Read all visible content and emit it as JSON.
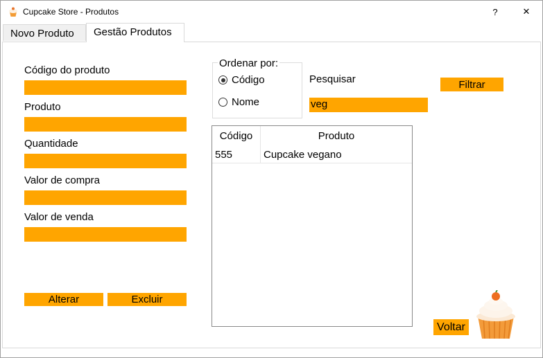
{
  "window": {
    "title": "Cupcake Store - Produtos",
    "help_label": "?",
    "close_label": "✕"
  },
  "tabs": [
    {
      "label": "Novo Produto",
      "active": false
    },
    {
      "label": "Gestão Produtos",
      "active": true
    }
  ],
  "form": {
    "codigo_label": "Código do produto",
    "codigo_value": "",
    "produto_label": "Produto",
    "produto_value": "",
    "quantidade_label": "Quantidade",
    "quantidade_value": "",
    "valor_compra_label": "Valor de compra",
    "valor_compra_value": "",
    "valor_venda_label": "Valor de venda",
    "valor_venda_value": "",
    "alterar_label": "Alterar",
    "excluir_label": "Excluir"
  },
  "order": {
    "legend": "Ordenar por:",
    "options": [
      {
        "label": "Código",
        "checked": true
      },
      {
        "label": "Nome",
        "checked": false
      }
    ]
  },
  "search": {
    "label": "Pesquisar",
    "value": "veg",
    "filter_label": "Filtrar"
  },
  "table": {
    "columns": [
      "Código",
      "Produto"
    ],
    "rows": [
      {
        "codigo": "555",
        "produto": "Cupcake vegano"
      }
    ]
  },
  "voltar_label": "Voltar",
  "colors": {
    "accent": "#ffa500"
  },
  "icons": {
    "app": "cupcake-icon",
    "decoration": "cupcake-illustration"
  }
}
